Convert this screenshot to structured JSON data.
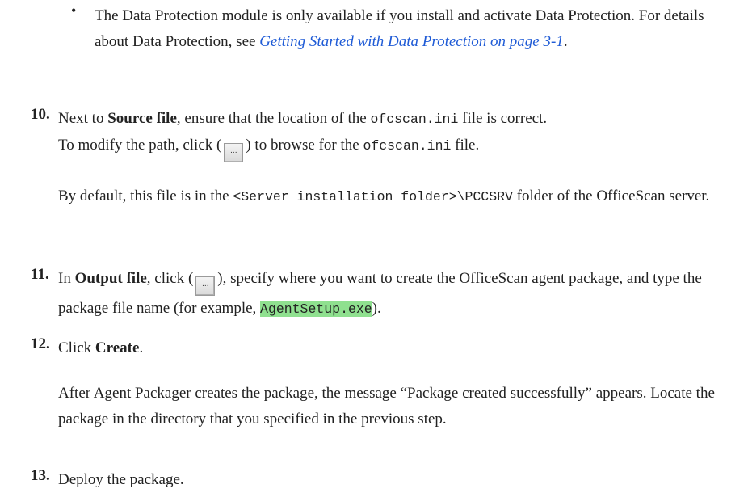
{
  "bullet": {
    "symbol": "•",
    "text_before_link": "The Data Protection module is only available if you install and activate Data Protection. For details about Data Protection, see ",
    "link_text": "Getting Started with Data Protection on page 3-1",
    "text_after_link": "."
  },
  "steps": [
    {
      "number": "10.",
      "line1_pre": "Next to ",
      "line1_bold": "Source file",
      "line1_mid": ", ensure that the location of the ",
      "line1_code": "ofcscan.ini",
      "line1_post": " file is correct.",
      "line2_pre": "To modify the path, click (",
      "line2_mid": ") to browse for the ",
      "line2_code": "ofcscan.ini",
      "line2_post": " file.",
      "note_pre": "By default, this file is in the ",
      "note_code": "<Server installation folder>\\PCCSRV",
      "note_post": " folder of the OfficeScan server."
    },
    {
      "number": "11.",
      "pre": "In ",
      "bold": "Output file",
      "mid1": ", click (",
      "mid2": "), specify where you want to create the OfficeScan agent package, and type the package file name (for example, ",
      "code": "AgentSetup.exe",
      "post": ")."
    },
    {
      "number": "12.",
      "pre": "Click ",
      "bold": "Create",
      "post": ".",
      "note": "After Agent Packager creates the package, the message “Package created successfully” appears. Locate the package in the directory that you specified in the previous step."
    },
    {
      "number": "13.",
      "text": "Deploy the package."
    }
  ],
  "browse_button_label": "..."
}
